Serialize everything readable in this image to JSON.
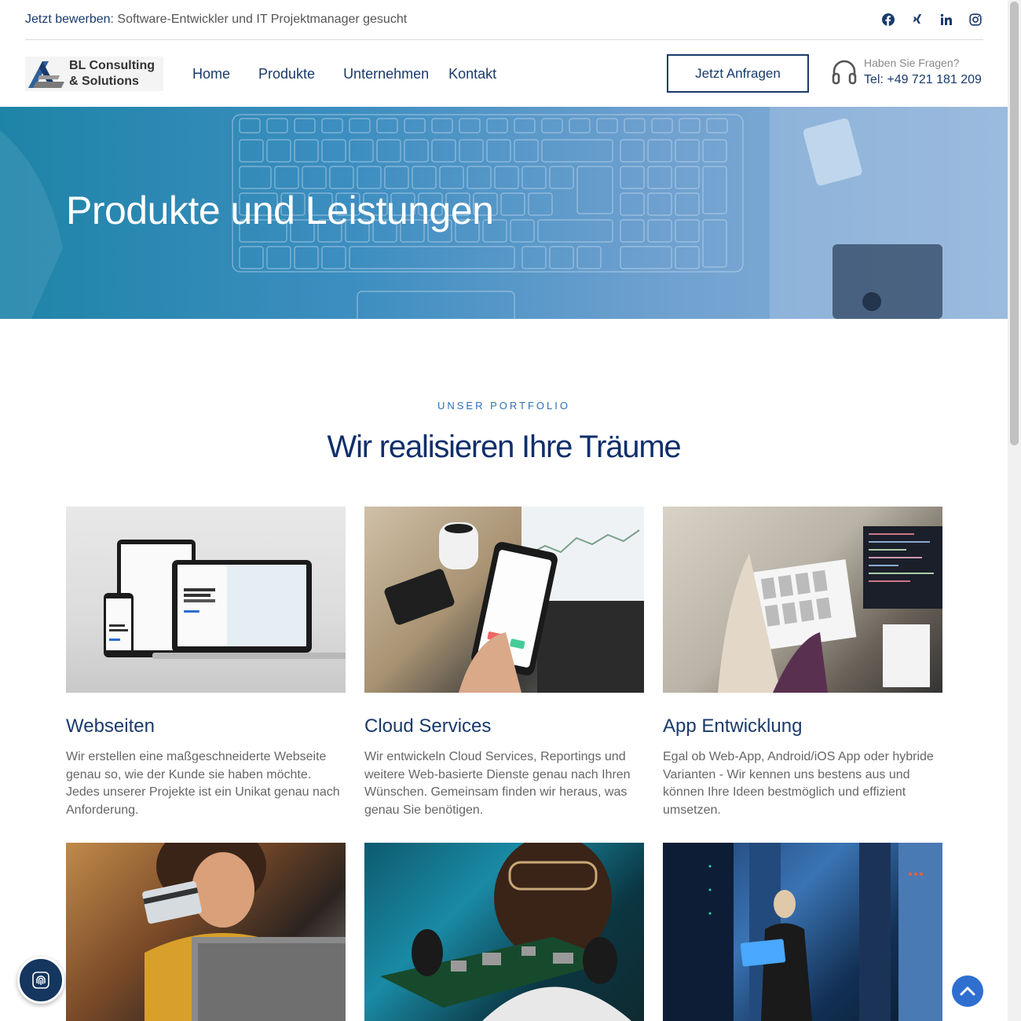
{
  "topbar": {
    "notice_em": "Jetzt bewerben",
    "notice_rest": ": Software-Entwickler und IT Projektmanager gesucht",
    "socials": [
      "facebook-icon",
      "xing-icon",
      "linkedin-icon",
      "instagram-icon"
    ]
  },
  "header": {
    "logo_line1": "BL Consulting",
    "logo_line2": "& Solutions",
    "nav": [
      "Home",
      "Produkte",
      "Unternehmen",
      "Kontakt"
    ],
    "cta": "Jetzt Anfragen",
    "support_question": "Haben Sie Fragen?",
    "support_tel": "Tel: +49 721 181 209"
  },
  "hero": {
    "title": "Produkte und Leistungen"
  },
  "section": {
    "overline": "UNSER PORTFOLIO",
    "title": "Wir realisieren Ihre Träume"
  },
  "cards": [
    {
      "title": "Webseiten",
      "text": "Wir erstellen eine maßgeschneiderte Webseite genau so, wie der Kunde sie haben möchte. Jedes unserer Projekte ist ein Unikat genau nach Anforderung."
    },
    {
      "title": "Cloud Services",
      "text": "Wir entwickeln Cloud Services, Reportings und weitere Web-basierte Dienste genau nach Ihren Wünschen. Gemeinsam finden wir heraus, was genau Sie benötigen."
    },
    {
      "title": "App Entwicklung",
      "text": "Egal ob Web-App, Android/iOS App oder hybride Varianten - Wir kennen uns bestens aus und können Ihre Ideen bestmöglich und effizient umsetzen."
    }
  ],
  "colors": {
    "primary": "#1a3a6b",
    "accent": "#2f6fb5",
    "button": "#2f6fd0"
  }
}
